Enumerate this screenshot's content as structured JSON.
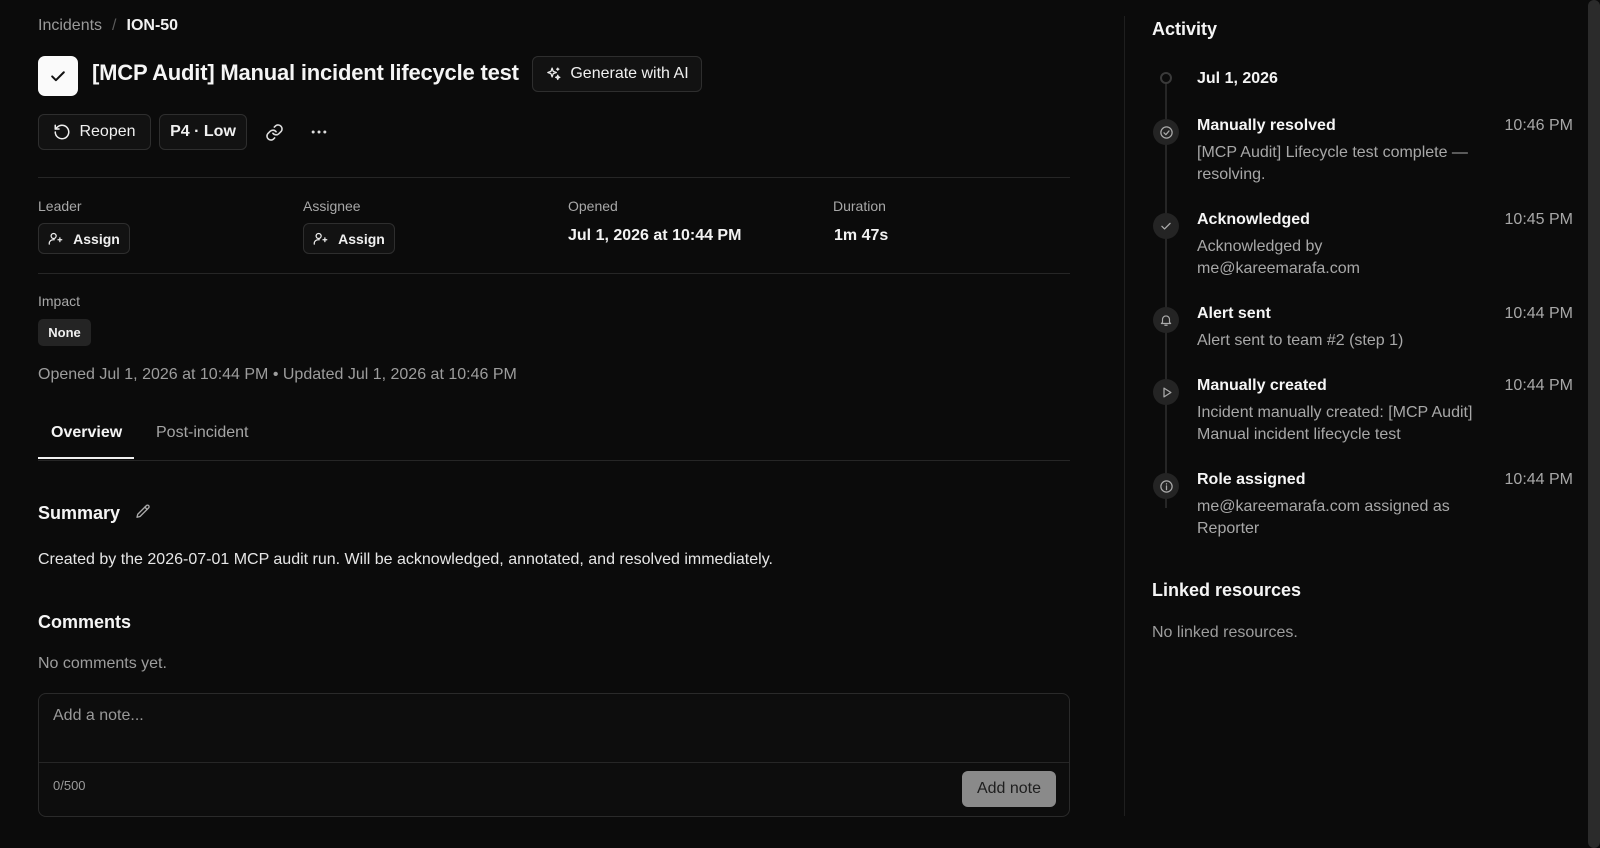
{
  "breadcrumb": {
    "parent": "Incidents",
    "separator": "/",
    "current": "ION-50"
  },
  "incident": {
    "title": "[MCP Audit] Manual incident lifecycle test",
    "status_icon": "check-icon"
  },
  "actions": {
    "generate_ai": "Generate with AI",
    "reopen": "Reopen",
    "priority": "P4 · Low",
    "link_icon": "link-icon",
    "more_icon": "more-horizontal-icon"
  },
  "fields": {
    "leader": {
      "label": "Leader",
      "button": "Assign"
    },
    "assignee": {
      "label": "Assignee",
      "button": "Assign"
    },
    "opened": {
      "label": "Opened",
      "value": "Jul 1, 2026 at 10:44 PM"
    },
    "duration": {
      "label": "Duration",
      "value": "1m 47s"
    }
  },
  "impact": {
    "label": "Impact",
    "value": "None"
  },
  "meta": "Opened Jul 1, 2026 at 10:44 PM • Updated Jul 1, 2026 at 10:46 PM",
  "tabs": [
    {
      "label": "Overview",
      "active": true
    },
    {
      "label": "Post-incident",
      "active": false
    }
  ],
  "summary": {
    "heading": "Summary",
    "text": "Created by the 2026-07-01 MCP audit run. Will be acknowledged, annotated, and resolved immediately."
  },
  "comments": {
    "heading": "Comments",
    "empty": "No comments yet.",
    "placeholder": "Add a note...",
    "counter": "0/500",
    "submit": "Add note"
  },
  "activity": {
    "heading": "Activity",
    "date": "Jul 1, 2026",
    "events": [
      {
        "title": "Manually resolved",
        "desc": "[MCP Audit] Lifecycle test complete — resolving.",
        "time": "10:46 PM",
        "icon": "check-circle-icon"
      },
      {
        "title": "Acknowledged",
        "desc": "Acknowledged by me@kareemarafa.com",
        "time": "10:45 PM",
        "icon": "check-icon"
      },
      {
        "title": "Alert sent",
        "desc": "Alert sent to team #2 (step 1)",
        "time": "10:44 PM",
        "icon": "bell-icon"
      },
      {
        "title": "Manually created",
        "desc": "Incident manually created: [MCP Audit] Manual incident lifecycle test",
        "time": "10:44 PM",
        "icon": "play-circle-icon"
      },
      {
        "title": "Role assigned",
        "desc": "me@kareemarafa.com assigned as Reporter",
        "time": "10:44 PM",
        "icon": "info-icon"
      }
    ]
  },
  "linked": {
    "heading": "Linked resources",
    "empty": "No linked resources."
  }
}
